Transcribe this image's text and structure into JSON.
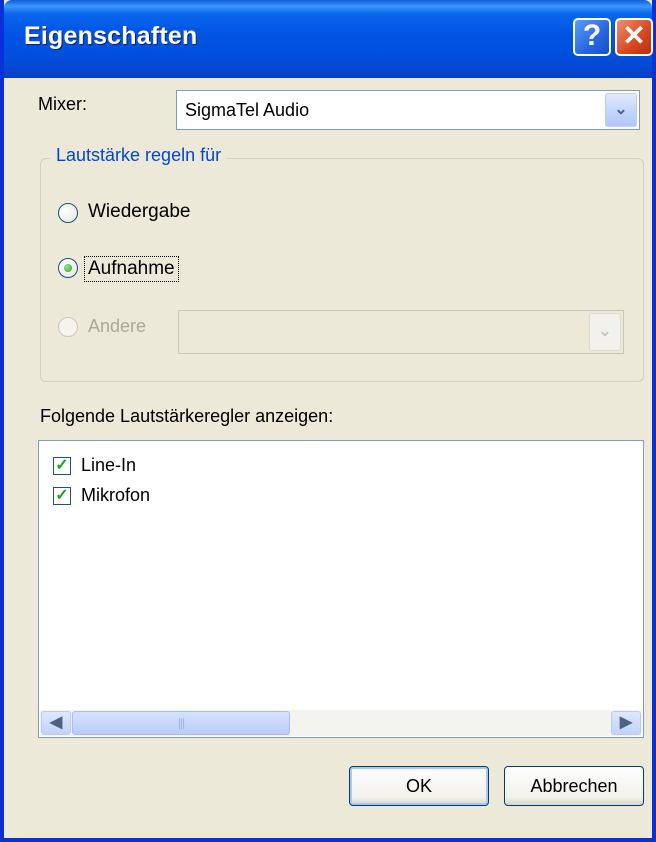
{
  "window": {
    "title": "Eigenschaften",
    "help_glyph": "?",
    "close_glyph": "✕"
  },
  "mixer": {
    "label": "Mixer:",
    "value": "SigmaTel Audio"
  },
  "volume_group": {
    "legend": "Lautstärke regeln für",
    "options": [
      {
        "label": "Wiedergabe",
        "selected": false,
        "enabled": true
      },
      {
        "label": "Aufnahme",
        "selected": true,
        "enabled": true
      },
      {
        "label": "Andere",
        "selected": false,
        "enabled": false
      }
    ],
    "other_device_value": ""
  },
  "controls_list": {
    "label": "Folgende Lautstärkeregler anzeigen:",
    "items": [
      {
        "label": "Line-In",
        "checked": true
      },
      {
        "label": "Mikrofon",
        "checked": true
      }
    ]
  },
  "buttons": {
    "ok": "OK",
    "cancel": "Abbrechen"
  },
  "colors": {
    "title_bar": "#0054e3",
    "window_bg": "#ece9d8",
    "group_legend": "#0046d5",
    "check_green": "#21a121"
  },
  "icons": {
    "combo_arrow": "chevron-down-icon",
    "scroll_left": "chevron-left-icon",
    "scroll_right": "chevron-right-icon",
    "check": "checkmark-icon"
  }
}
